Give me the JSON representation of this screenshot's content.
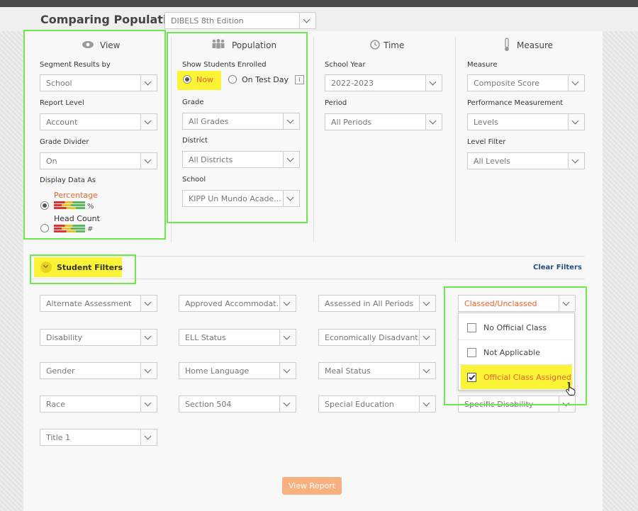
{
  "header": {
    "title": "Comparing Populations",
    "assessment": "DIBELS 8th Edition"
  },
  "view": {
    "title": "View",
    "segment_label": "Segment Results by",
    "segment_value": "School",
    "report_level_label": "Report Level",
    "report_level_value": "Account",
    "grade_divider_label": "Grade Divider",
    "grade_divider_value": "On",
    "display_label": "Display Data As",
    "percentage_label": "Percentage",
    "percentage_symbol": "%",
    "headcount_label": "Head Count",
    "headcount_symbol": "#"
  },
  "population": {
    "title": "Population",
    "enrolled_label": "Show Students Enrolled",
    "now_label": "Now",
    "test_day_label": "On Test Day",
    "info_label": "i",
    "grade_label": "Grade",
    "grade_value": "All Grades",
    "district_label": "District",
    "district_value": "All Districts",
    "school_label": "School",
    "school_value": "KIPP Un Mundo Acade..."
  },
  "time": {
    "title": "Time",
    "year_label": "School Year",
    "year_value": "2022-2023",
    "period_label": "Period",
    "period_value": "All Periods"
  },
  "measure": {
    "title": "Measure",
    "measure_label": "Measure",
    "measure_value": "Composite Score",
    "perf_label": "Performance Measurement",
    "perf_value": "Levels",
    "level_filter_label": "Level Filter",
    "level_filter_value": "All Levels"
  },
  "filters": {
    "title": "Student Filters",
    "clear_label": "Clear Filters",
    "items": [
      "Alternate Assessment",
      "Approved Accommodat...",
      "Assessed in All Periods",
      "Classed/Unclassed",
      "Disability",
      "ELL Status",
      "Economically Disadvant...",
      "Gender",
      "Home Language",
      "Meal Status",
      "Race",
      "Section 504",
      "Special Education",
      "Specific Disability",
      "Title 1"
    ],
    "dropdown_options": [
      "No Official Class",
      "Not Applicable",
      "Official Class Assigned"
    ]
  },
  "view_report_label": "View Report",
  "colors": {
    "accent": "#e8642a",
    "highlight_green": "#6ee84f",
    "highlight_yellow": "#fbf336"
  }
}
